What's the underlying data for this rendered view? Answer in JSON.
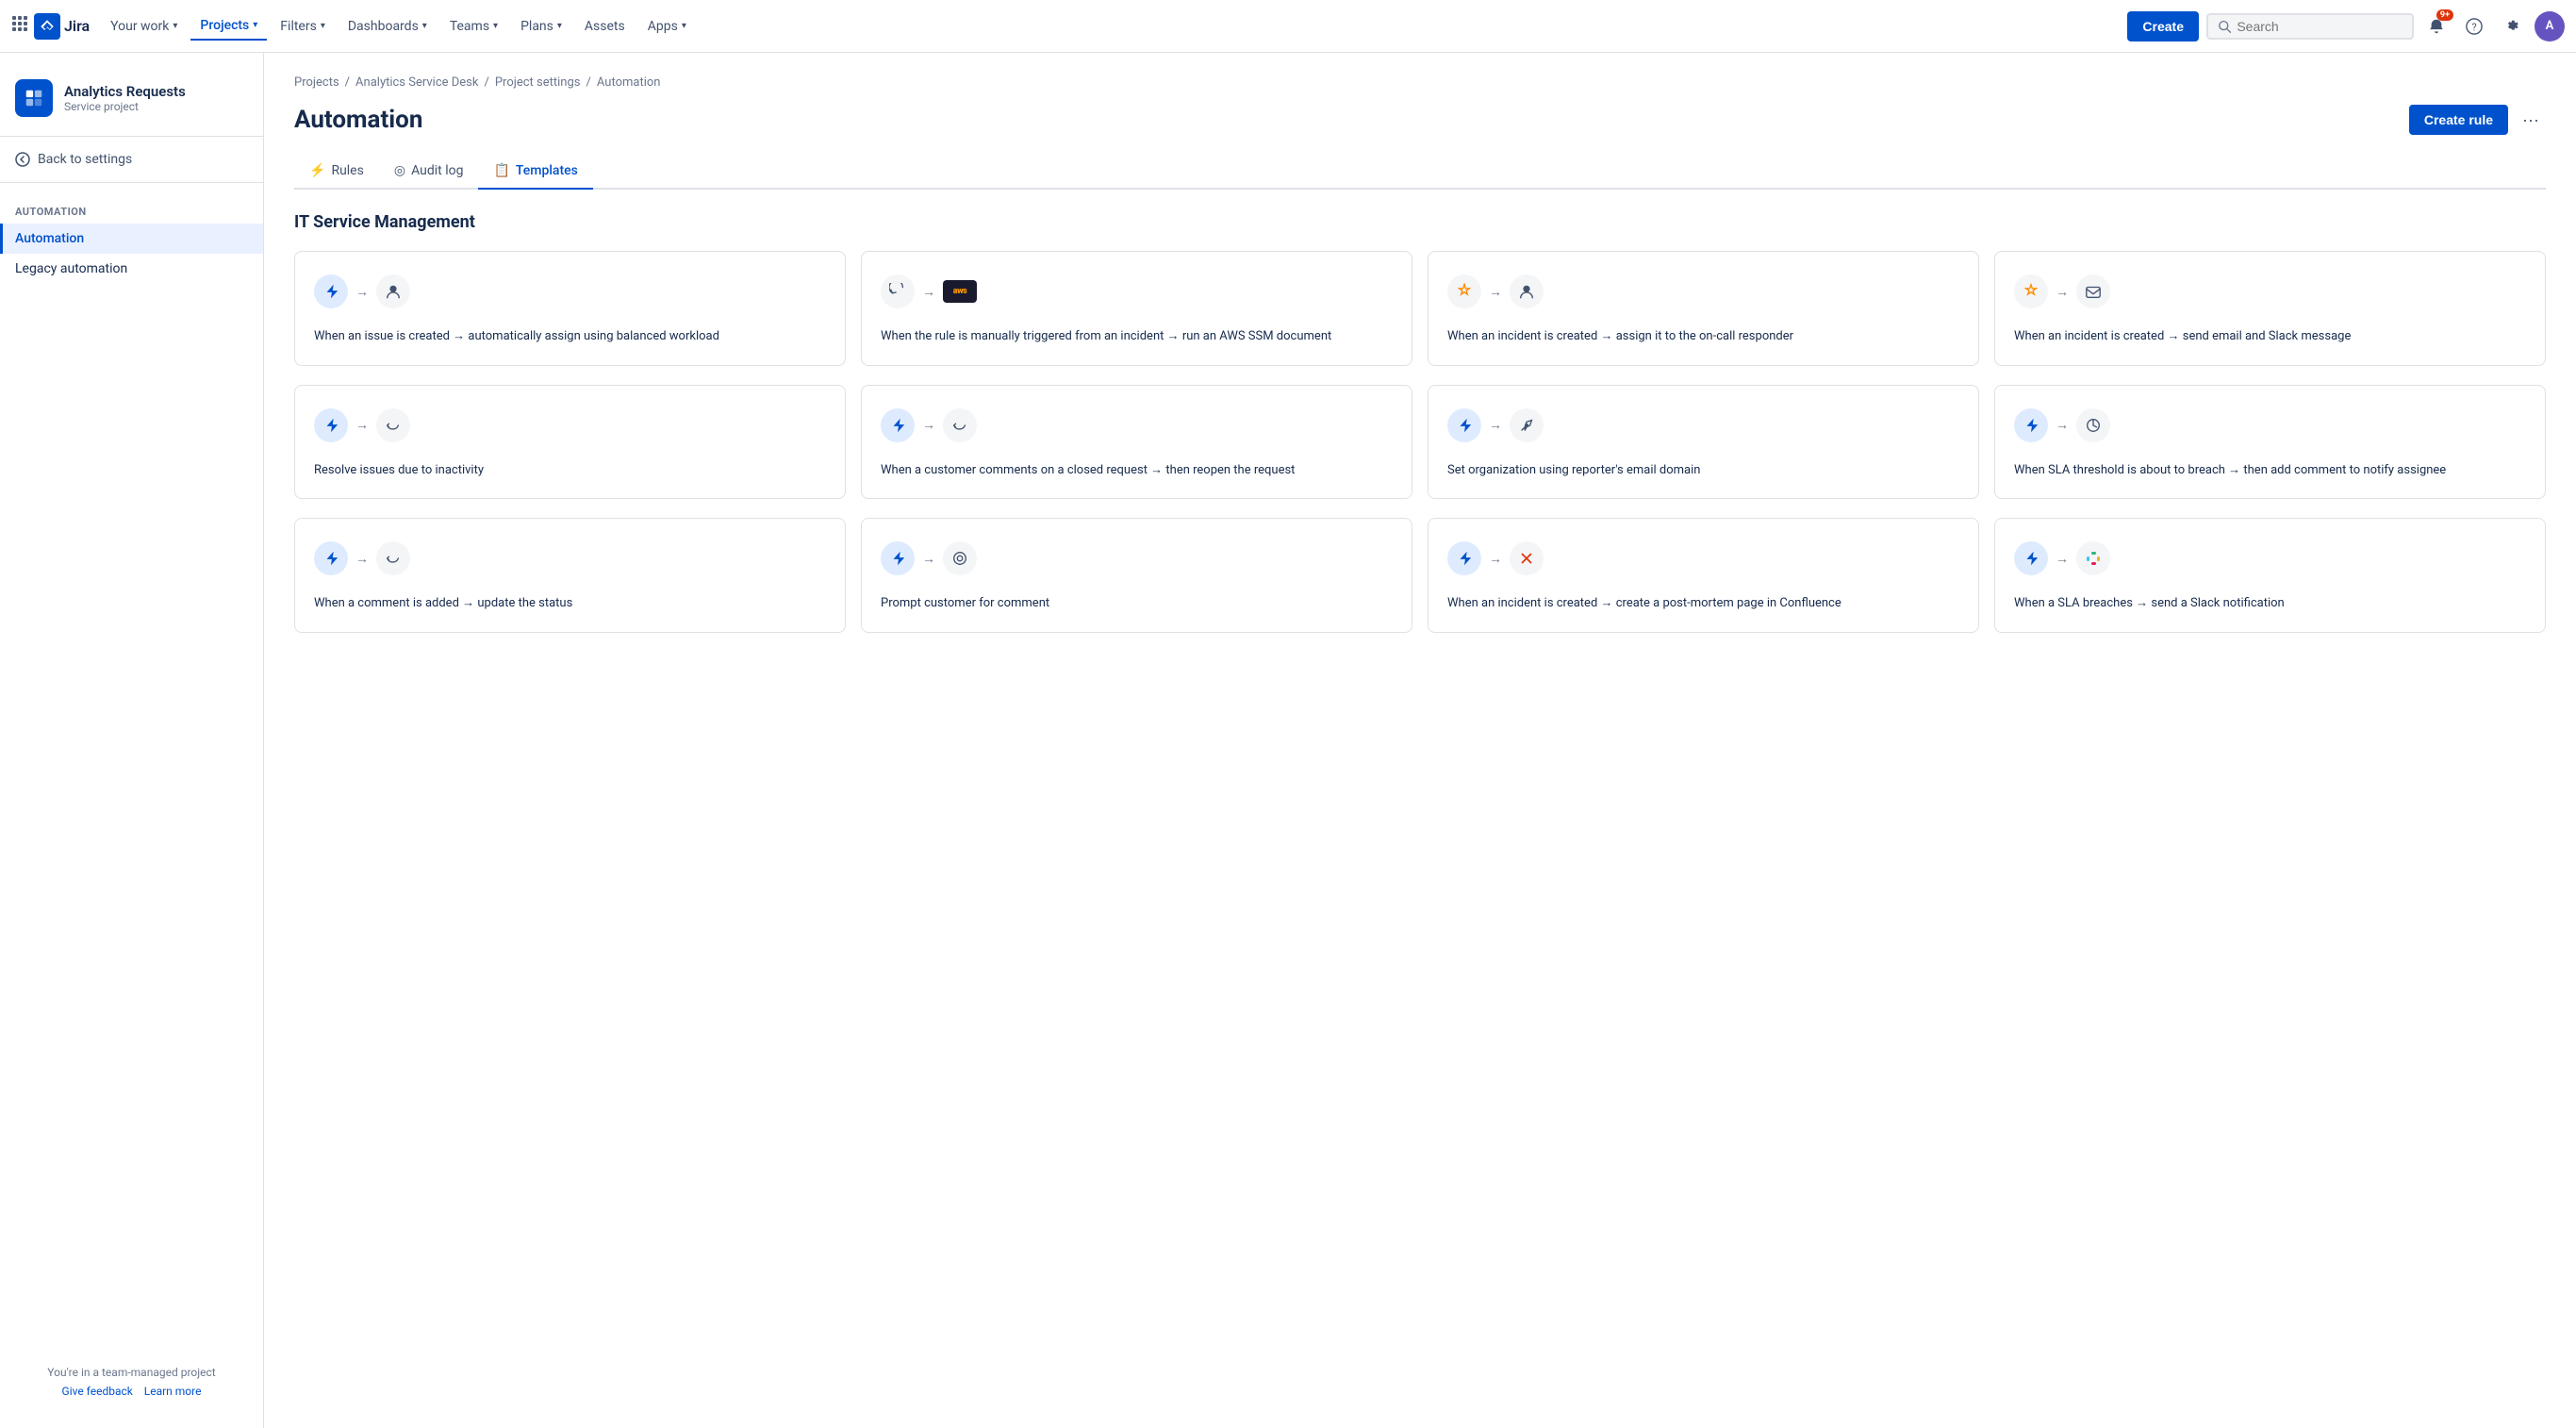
{
  "topnav": {
    "grid_icon": "⋮⋮⋮",
    "logo_text": "Jira",
    "nav_items": [
      {
        "label": "Your work",
        "active": false,
        "has_chevron": true
      },
      {
        "label": "Projects",
        "active": true,
        "has_chevron": true
      },
      {
        "label": "Filters",
        "active": false,
        "has_chevron": true
      },
      {
        "label": "Dashboards",
        "active": false,
        "has_chevron": true
      },
      {
        "label": "Teams",
        "active": false,
        "has_chevron": true
      },
      {
        "label": "Plans",
        "active": false,
        "has_chevron": true
      },
      {
        "label": "Assets",
        "active": false,
        "has_chevron": false
      },
      {
        "label": "Apps",
        "active": false,
        "has_chevron": true
      }
    ],
    "create_label": "Create",
    "search_placeholder": "Search",
    "notifications_badge": "9+",
    "avatar_initials": "A"
  },
  "sidebar": {
    "project_name": "Analytics Requests",
    "project_type": "Service project",
    "project_icon": "🔷",
    "back_label": "Back to settings",
    "section_label": "AUTOMATION",
    "nav_items": [
      {
        "label": "Automation",
        "active": true
      },
      {
        "label": "Legacy automation",
        "active": false
      }
    ],
    "footer_line1": "You're in a team-managed project",
    "give_feedback": "Give feedback",
    "learn_more": "Learn more"
  },
  "breadcrumb": {
    "items": [
      "Projects",
      "Analytics Service Desk",
      "Project settings",
      "Automation"
    ]
  },
  "page": {
    "title": "Automation",
    "create_rule_label": "Create rule",
    "more_icon": "···"
  },
  "tabs": [
    {
      "label": "Rules",
      "icon": "⚡",
      "active": false
    },
    {
      "label": "Audit log",
      "icon": "◎",
      "active": false
    },
    {
      "label": "Templates",
      "icon": "📋",
      "active": true
    }
  ],
  "section": {
    "title": "IT Service Management"
  },
  "cards_row1": [
    {
      "icon1": "⚡",
      "icon1_type": "blue",
      "icon2": "👤",
      "icon2_type": "grey",
      "text": "When an issue is created → automatically assign using balanced workload"
    },
    {
      "icon1": "🔧",
      "icon1_type": "grey",
      "icon2": "aws",
      "icon2_type": "grey",
      "text": "When the rule is manually triggered from an incident → run an AWS SSM document"
    },
    {
      "icon1": "⚠",
      "icon1_type": "grey",
      "icon2": "👤",
      "icon2_type": "grey",
      "text": "When an incident is created → assign it to the on-call responder"
    },
    {
      "icon1": "⚠",
      "icon1_type": "grey",
      "icon2": "✉",
      "icon2_type": "grey",
      "text": "When an incident is created → send email and Slack message"
    }
  ],
  "cards_row2": [
    {
      "icon1": "⚡",
      "icon1_type": "blue",
      "icon2": "↩",
      "icon2_type": "grey",
      "text": "Resolve issues due to inactivity"
    },
    {
      "icon1": "⚡",
      "icon1_type": "blue",
      "icon2": "↩",
      "icon2_type": "grey",
      "text": "When a customer comments on a closed request → then reopen the request"
    },
    {
      "icon1": "⚡",
      "icon1_type": "blue",
      "icon2": "✏",
      "icon2_type": "grey",
      "text": "Set organization using reporter's email domain"
    },
    {
      "icon1": "⚡",
      "icon1_type": "blue",
      "icon2": "↻",
      "icon2_type": "grey",
      "text": "When SLA threshold is about to breach → then add comment to notify assignee"
    }
  ],
  "cards_row3": [
    {
      "icon1": "⚡",
      "icon1_type": "blue",
      "icon2": "↩",
      "icon2_type": "grey",
      "text": "When a comment is added → update the status"
    },
    {
      "icon1": "⚡",
      "icon1_type": "blue",
      "icon2": "↻",
      "icon2_type": "grey",
      "text": "Prompt customer for comment"
    },
    {
      "icon1": "⚡",
      "icon1_type": "blue",
      "icon2": "✕",
      "icon2_type": "grey",
      "text": "When an incident is created → create a post-mortem page in Confluence"
    },
    {
      "icon1": "⚡",
      "icon1_type": "blue",
      "icon2": "#",
      "icon2_type": "grey",
      "text": "When a SLA breaches → send a Slack notification"
    }
  ]
}
